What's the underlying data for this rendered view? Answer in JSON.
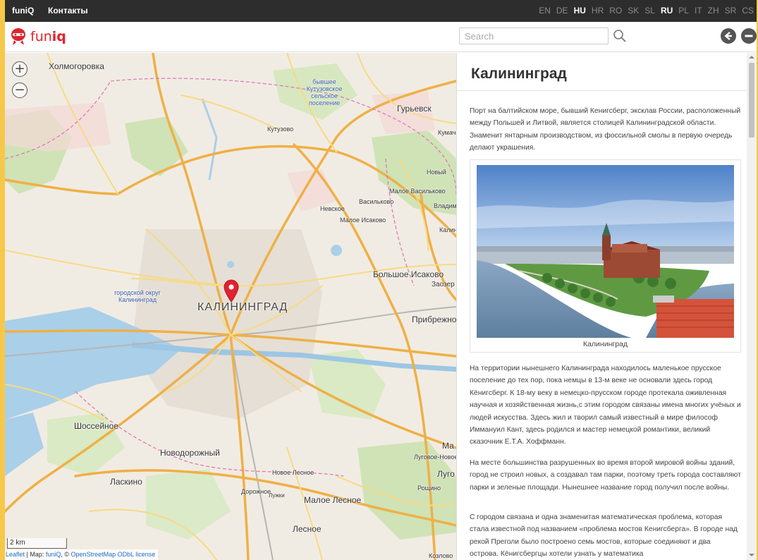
{
  "topbar": {
    "brand": "funiQ",
    "contacts": "Контакты",
    "languages": [
      {
        "code": "EN",
        "active": false
      },
      {
        "code": "DE",
        "active": false
      },
      {
        "code": "HU",
        "active": true
      },
      {
        "code": "HR",
        "active": false
      },
      {
        "code": "RO",
        "active": false
      },
      {
        "code": "SK",
        "active": false
      },
      {
        "code": "SL",
        "active": false
      },
      {
        "code": "RU",
        "active": true
      },
      {
        "code": "PL",
        "active": false
      },
      {
        "code": "IT",
        "active": false
      },
      {
        "code": "ZH",
        "active": false
      },
      {
        "code": "SR",
        "active": false
      },
      {
        "code": "CS",
        "active": false
      }
    ]
  },
  "header": {
    "logo_text_plain": "fun",
    "logo_text_bold": "iq",
    "search_placeholder": "Search",
    "icons": [
      "search-icon",
      "back-arrow-icon",
      "minus-circle-icon"
    ]
  },
  "map": {
    "labels": {
      "kholmogorovka": "Холмогоровка",
      "former_kutuzov": "бывшее Кутузовское сельское поселение",
      "guryevsk": "Гурьевск",
      "kutuzovo": "Кутузово",
      "kumach": "Кумачё",
      "novyi": "Новый",
      "maloe_vasilkovo": "Малое Васильково",
      "vasilkovo": "Васильково",
      "nevskoe": "Невское",
      "vladimirovo": "Владими",
      "maloe_isakovo": "Малое Исаково",
      "kalin_right": "Калин",
      "bolshoe_isakovo": "Большое Исаково",
      "zaozerye": "Заозер",
      "city_district": "городской округ Калининград",
      "kaliningrad_big": "КАЛИНИНГРАД",
      "pribrezhnoe": "Прибрежно",
      "shosseinoe": "Шоссейное",
      "novodorozhny": "Новодорожный",
      "ma_right": "Ма",
      "lugovoe_novoe": "Луговое-Новое",
      "lugo": "Луго",
      "novoe_lesnoe": "Новое Лесное",
      "laskino": "Ласкино",
      "roshchino": "Рощино",
      "dorozhnoe": "Дорожное",
      "luzhki": "Лужки",
      "maloe_lesnoe": "Малое Лесное",
      "lesnoe": "Лесное",
      "kozlovo": "Козлово"
    },
    "scale": "2 km",
    "attribution": {
      "leaflet": "Leaflet",
      "sep1": " | Map: ",
      "funiq": "funiQ",
      "sep2": ", © ",
      "osm": "OpenStreetMap",
      "sep3": " ",
      "odbl": "ODbL license"
    },
    "zoom_in": "+",
    "zoom_out": "−"
  },
  "panel": {
    "title": "Калининград",
    "intro": "Порт на балтийском море, бывший Кенигсберг, эксклав России, расположенный между Польшей и Литвой, является столицей Калининградской области. Знаменит янтарным производством, из фоссильной смолы в первую очередь делают украшения.",
    "image_caption": "Калининград",
    "paragraphs": [
      "На территории нынешнего Калининграда находилось маленькое прусское поселение до тех пор, пока немцы в 13-м веке не основали здесь город Кёнигсберг. К 18-му веку в немецко-прусском городе протекала оживленная научная и хозяйственная жизнь,с этим городом связаны имена многих учёных и людей искусства. Здесь жил и творил самый известный в мире философ Иммануил Кант, здесь родился и мастер немецкой романтики, великий сказочник Е.Т.А. Хоффманн.",
      "На месте большинства разрушенных во время второй мировой войны зданий, город не строил новых, а создавал там парки, поэтому треть города составляют парки и зеленые площади. Нынешнее название город получил после войны.",
      "С городом связана и одна знаменитая математическая проблема, которая стала известной под названием «проблема мостов Кенигсберга». В городе над рекой Преголи было построено семь мостов, которые соединяют и два острова. Кёнигсбергцы хотели узнать у математика"
    ]
  },
  "colors": {
    "brand_red": "#e0232e",
    "topbar_bg": "#2d2d2d",
    "road_major": "#f2b33d",
    "road_minor": "#f6d77c",
    "water": "#aacfe9",
    "forest": "#c6deae"
  }
}
